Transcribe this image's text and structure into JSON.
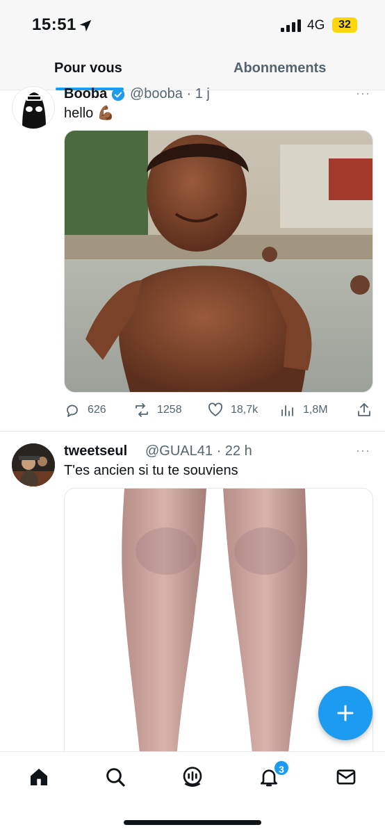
{
  "status_bar": {
    "time": "15:51",
    "network": "4G",
    "battery": "32"
  },
  "tabs": [
    {
      "label": "Pour vous",
      "active": true
    },
    {
      "label": "Abonnements",
      "active": false
    }
  ],
  "tweets": [
    {
      "name": "Booba",
      "verified": true,
      "handle": "@booba · 1 j",
      "text": "hello 💪🏾",
      "media_icon": "photo",
      "stats": {
        "replies": "626",
        "retweets": "1258",
        "likes": "18,7k",
        "views": "1,8M"
      }
    },
    {
      "name": "tweetseul",
      "verified": false,
      "handle": "@GUAL41 · 22 h",
      "text": "T'es ancien si tu te souviens",
      "media_icon": "photo"
    }
  ],
  "more_glyph": "···",
  "fab": {
    "icon": "compose-plus-icon",
    "color": "#1d9bf0"
  },
  "bottom_nav": [
    {
      "name": "home-icon"
    },
    {
      "name": "search-icon"
    },
    {
      "name": "spaces-icon"
    },
    {
      "name": "notifications-icon",
      "badge": "3"
    },
    {
      "name": "messages-icon"
    }
  ],
  "colors": {
    "accent": "#1d9bf0",
    "text": "#0f1419",
    "muted": "#536471"
  }
}
